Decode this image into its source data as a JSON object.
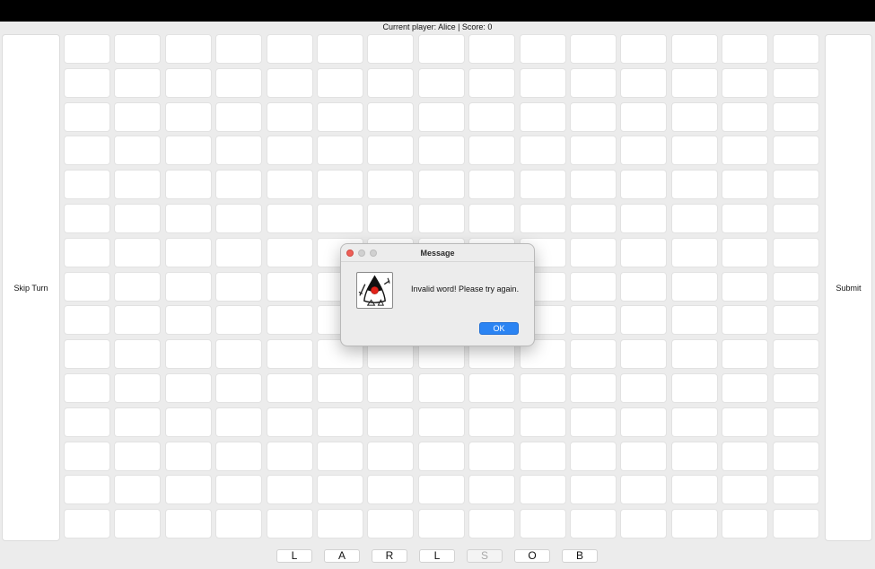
{
  "status_bar": {
    "text": "Current player: Alice | Score: 0"
  },
  "actions": {
    "skip_label": "Skip Turn",
    "submit_label": "Submit"
  },
  "board": {
    "rows": 15,
    "columns": 15
  },
  "rack": {
    "tiles": [
      {
        "letter": "L",
        "enabled": true
      },
      {
        "letter": "A",
        "enabled": true
      },
      {
        "letter": "R",
        "enabled": true
      },
      {
        "letter": "L",
        "enabled": true
      },
      {
        "letter": "S",
        "enabled": false
      },
      {
        "letter": "O",
        "enabled": true
      },
      {
        "letter": "B",
        "enabled": true
      }
    ]
  },
  "dialog": {
    "title": "Message",
    "message": "Invalid word! Please try again.",
    "ok_label": "OK",
    "icon": "java-duke-icon",
    "accent_color": "#2b84f3"
  }
}
